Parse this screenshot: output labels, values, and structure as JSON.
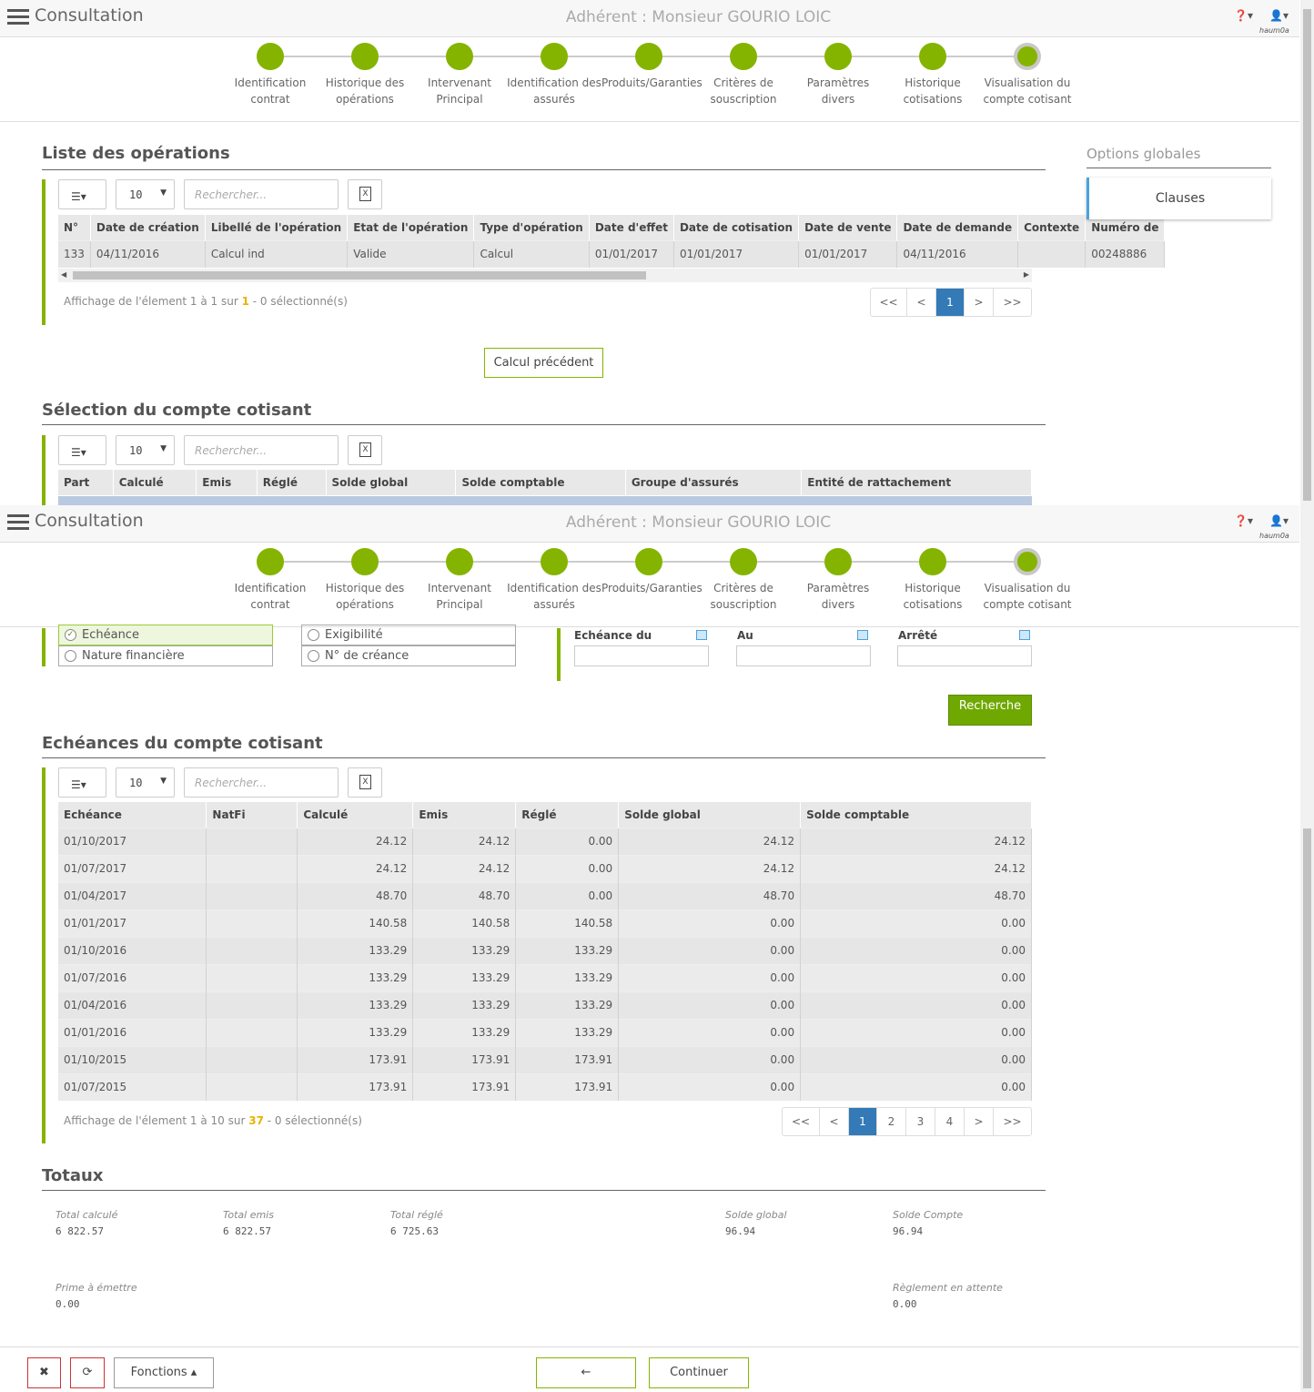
{
  "header": {
    "app_title": "Consultation",
    "adherent": "Adhérent : Monsieur GOURIO LOIC",
    "help_icon": "?",
    "user_icon": "user-icon",
    "username": "haum0a"
  },
  "steps": [
    {
      "label": "Identification contrat"
    },
    {
      "label": "Historique des opérations"
    },
    {
      "label": "Intervenant Principal"
    },
    {
      "label": "Identification des assurés"
    },
    {
      "label": "Produits/Garanties"
    },
    {
      "label": "Critères de souscription"
    },
    {
      "label": "Paramètres divers"
    },
    {
      "label": "Historique cotisations"
    },
    {
      "label": "Visualisation du compte cotisant"
    }
  ],
  "operations": {
    "title": "Liste des opérations",
    "page_size": "10",
    "search_placeholder": "Rechercher...",
    "columns": [
      "N°",
      "Date de création",
      "Libellé de l'opération",
      "Etat de l'opération",
      "Type d'opération",
      "Date d'effet",
      "Date de cotisation",
      "Date de vente",
      "Date de demande",
      "Contexte",
      "Numéro de"
    ],
    "row": [
      "133",
      "04/11/2016",
      "Calcul ind",
      "Valide",
      "Calcul",
      "01/01/2017",
      "01/01/2017",
      "01/01/2017",
      "04/11/2016",
      "",
      "00248886"
    ],
    "info_prefix": "Affichage de l'élement 1 à 1 sur ",
    "info_total": "1",
    "info_suffix": " - 0 sélectionné(s)",
    "pager": [
      "<<",
      "<",
      "1",
      ">",
      ">>"
    ],
    "prev_calc_button": "Calcul précédent"
  },
  "compte": {
    "title": "Sélection du compte cotisant",
    "page_size": "10",
    "search_placeholder": "Rechercher...",
    "columns": [
      "Part",
      "Calculé",
      "Emis",
      "Réglé",
      "Solde global",
      "Solde comptable",
      "Groupe d'assurés",
      "Entité de rattachement"
    ]
  },
  "filters": {
    "echeance": "Echéance",
    "exigibilite": "Exigibilité",
    "nature": "Nature financière",
    "creance": "N° de créance",
    "echeance_du": "Echéance du",
    "au": "Au",
    "arrete": "Arrêté",
    "search_button": "Recherche"
  },
  "echeances": {
    "title": "Echéances du compte cotisant",
    "page_size": "10",
    "search_placeholder": "Rechercher...",
    "columns": [
      "Echéance",
      "NatFi",
      "Calculé",
      "Emis",
      "Réglé",
      "Solde global",
      "Solde comptable"
    ],
    "rows": [
      [
        "01/10/2017",
        "",
        "24.12",
        "24.12",
        "0.00",
        "24.12",
        "24.12"
      ],
      [
        "01/07/2017",
        "",
        "24.12",
        "24.12",
        "0.00",
        "24.12",
        "24.12"
      ],
      [
        "01/04/2017",
        "",
        "48.70",
        "48.70",
        "0.00",
        "48.70",
        "48.70"
      ],
      [
        "01/01/2017",
        "",
        "140.58",
        "140.58",
        "140.58",
        "0.00",
        "0.00"
      ],
      [
        "01/10/2016",
        "",
        "133.29",
        "133.29",
        "133.29",
        "0.00",
        "0.00"
      ],
      [
        "01/07/2016",
        "",
        "133.29",
        "133.29",
        "133.29",
        "0.00",
        "0.00"
      ],
      [
        "01/04/2016",
        "",
        "133.29",
        "133.29",
        "133.29",
        "0.00",
        "0.00"
      ],
      [
        "01/01/2016",
        "",
        "133.29",
        "133.29",
        "133.29",
        "0.00",
        "0.00"
      ],
      [
        "01/10/2015",
        "",
        "173.91",
        "173.91",
        "173.91",
        "0.00",
        "0.00"
      ],
      [
        "01/07/2015",
        "",
        "173.91",
        "173.91",
        "173.91",
        "0.00",
        "0.00"
      ]
    ],
    "info_prefix": "Affichage de l'élement 1 à 10 sur ",
    "info_total": "37",
    "info_suffix": " - 0 sélectionné(s)",
    "pager": [
      "<<",
      "<",
      "1",
      "2",
      "3",
      "4",
      ">",
      ">>"
    ]
  },
  "totaux": {
    "title": "Totaux",
    "total_calcule_label": "Total calculé",
    "total_calcule": "6 822.57",
    "total_emis_label": "Total emis",
    "total_emis": "6 822.57",
    "total_regle_label": "Total réglé",
    "total_regle": "6 725.63",
    "solde_global_label": "Solde global",
    "solde_global": "96.94",
    "solde_compte_label": "Solde Compte",
    "solde_compte": "96.94",
    "prime_label": "Prime à émettre",
    "prime": "0.00",
    "reglement_label": "Règlement en attente",
    "reglement": "0.00"
  },
  "options": {
    "title": "Options globales",
    "clauses": "Clauses"
  },
  "footer": {
    "close_icon": "✖",
    "refresh_icon": "⟳",
    "fonctions": "Fonctions",
    "back_icon": "🡐",
    "continuer": "Continuer"
  }
}
